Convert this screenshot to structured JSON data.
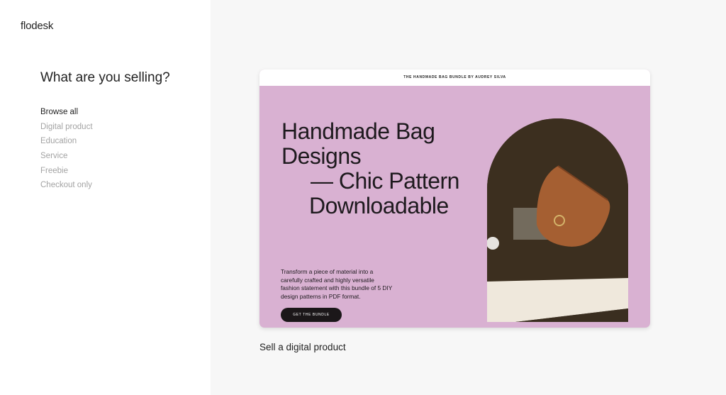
{
  "sidebar": {
    "logo": "flodesk",
    "question": "What are you selling?",
    "categories": [
      {
        "label": "Browse all",
        "active": true
      },
      {
        "label": "Digital product"
      },
      {
        "label": "Education"
      },
      {
        "label": "Service"
      },
      {
        "label": "Freebie"
      },
      {
        "label": "Checkout only"
      }
    ]
  },
  "template": {
    "header": "THE HANDMADE BAG BUNDLE BY AUDREY SILVA",
    "title_lines": [
      "Handmade Bag",
      "Designs",
      "— Chic Pattern",
      "Downloadable"
    ],
    "description": "Transform a piece of material into a carefully crafted and highly versatile fashion statement with this bundle of 5 DIY design patterns in PDF format.",
    "button": "GET THE BUNDLE",
    "background_color": "#d9b1d2"
  },
  "caption": "Sell a digital product"
}
